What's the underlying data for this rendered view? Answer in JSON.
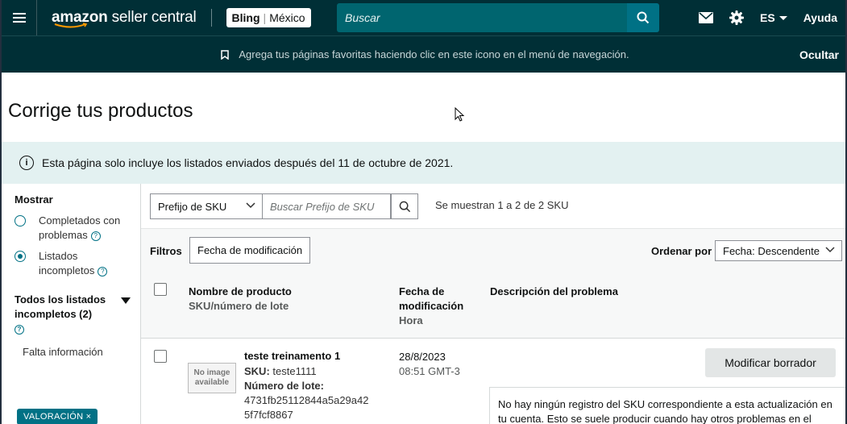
{
  "topnav": {
    "logo_prefix": "amazon",
    "logo_suffix": " seller central",
    "store_name": "Bling",
    "store_region": "México",
    "search_placeholder": "Buscar",
    "language": "ES",
    "help": "Ayuda"
  },
  "favbar": {
    "message": "Agrega tus páginas favoritas haciendo clic en este icono en el menú de navegación.",
    "hide": "Ocultar"
  },
  "page": {
    "title": "Corrige tus productos",
    "info": "Esta página solo incluye los listados enviados después del 11 de octubre de 2021."
  },
  "sidebar": {
    "header": "Mostrar",
    "options": [
      {
        "label": "Completados con problemas",
        "selected": false
      },
      {
        "label": "Listados incompletos",
        "selected": true
      }
    ],
    "all_incomplete": "Todos los listados incompletos (2)",
    "missing_info": "Falta información",
    "pill": "VALORACIÓN ×"
  },
  "filters": {
    "sku_select": "Prefijo de SKU",
    "sku_placeholder": "Buscar Prefijo de SKU",
    "count_text": "Se muestran 1 a 2 de 2 SKU",
    "filters_label": "Filtros",
    "chip": "Fecha de modificación",
    "sort_label": "Ordenar por",
    "sort_value": "Fecha: Descendente"
  },
  "table": {
    "col_product": "Nombre de producto",
    "col_product_sub": "SKU/número de lote",
    "col_date": "Fecha de modificación",
    "col_date_sub": "Hora",
    "col_problem": "Descripción del problema"
  },
  "rows": [
    {
      "image_text": "No image available",
      "name": "teste treinamento 1",
      "sku_label": "SKU:",
      "sku": "teste1111",
      "lot_label": "Número de lote:",
      "lot_1": "4731fb25112844a5a29a42",
      "lot_2": "5f7fcf8867",
      "date": "28/8/2023",
      "time": "08:51 GMT-3",
      "action": "Modificar borrador",
      "problem": "No hay ningún registro del SKU correspondiente a esta actualización en tu cuenta. Esto se suele producir cuando hay otros problemas en el"
    }
  ],
  "colors": {
    "nav_bg": "#002f36",
    "search_bg": "#00656f",
    "accent": "#007185",
    "banner_bg": "#e3f1f1"
  }
}
